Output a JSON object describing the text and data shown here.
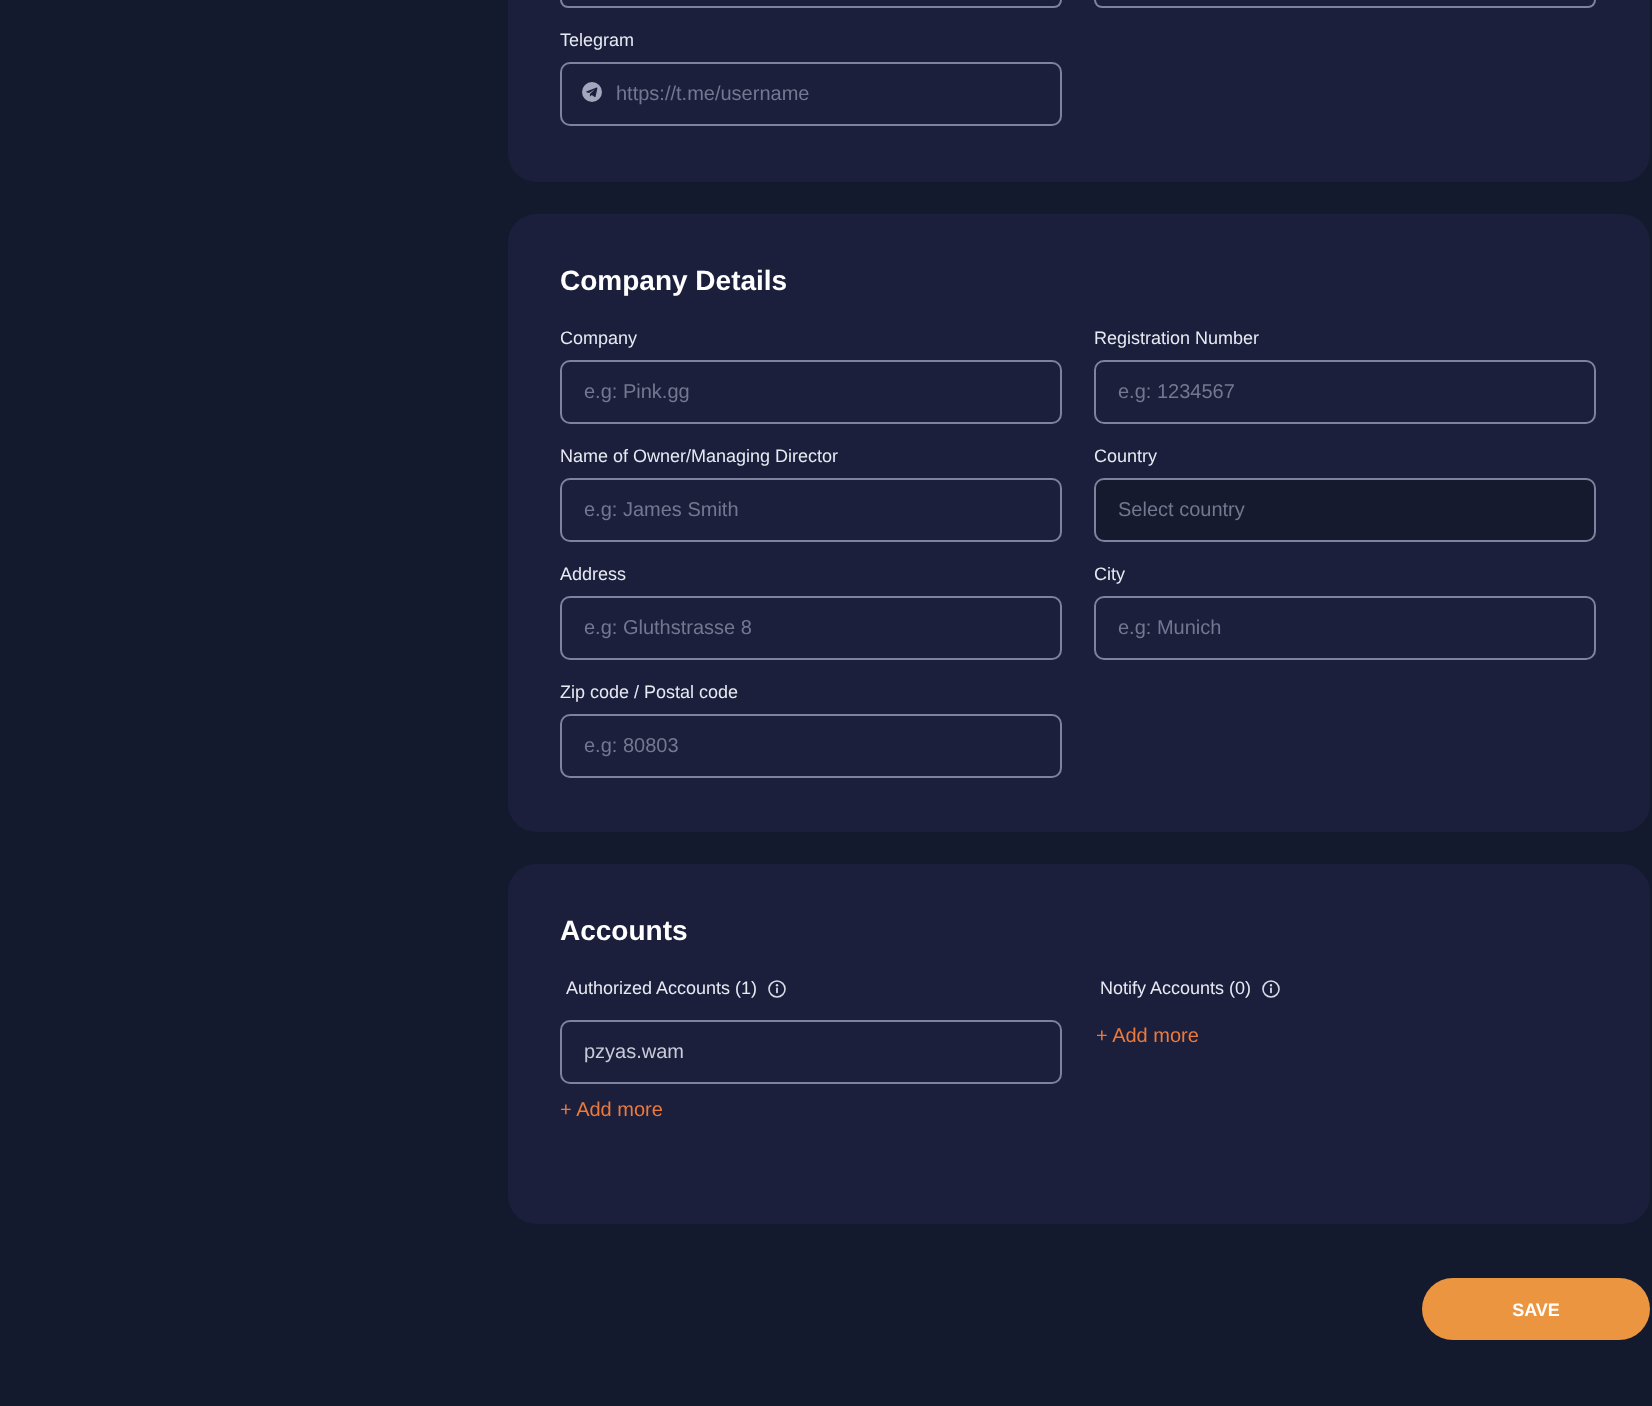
{
  "contact_card": {
    "fields": [
      {
        "kind": "stub"
      },
      {
        "kind": "stub"
      },
      {
        "kind": "telegram",
        "label": "Telegram",
        "placeholder": "https://t.me/username"
      }
    ]
  },
  "company_details": {
    "title": "Company Details",
    "fields": [
      {
        "kind": "input",
        "label": "Company",
        "placeholder": "e.g: Pink.gg"
      },
      {
        "kind": "input",
        "label": "Registration Number",
        "placeholder": "e.g: 1234567"
      },
      {
        "kind": "input",
        "label": "Name of Owner/Managing Director",
        "placeholder": "e.g: James Smith"
      },
      {
        "kind": "select",
        "label": "Country",
        "placeholder": "Select country"
      },
      {
        "kind": "input",
        "label": "Address",
        "placeholder": "e.g: Gluthstrasse 8"
      },
      {
        "kind": "input",
        "label": "City",
        "placeholder": "e.g: Munich"
      },
      {
        "kind": "input",
        "label": "Zip code / Postal code",
        "placeholder": "e.g: 80803"
      }
    ]
  },
  "accounts": {
    "title": "Accounts",
    "groups": [
      {
        "label": "Authorized Accounts (1)",
        "accounts": [
          {
            "value": "pzyas.wam"
          }
        ],
        "add_link": "+ Add more"
      },
      {
        "label": "Notify Accounts (0)",
        "add_link": "+ Add more"
      }
    ]
  },
  "save_button": {
    "label": "SAVE"
  }
}
